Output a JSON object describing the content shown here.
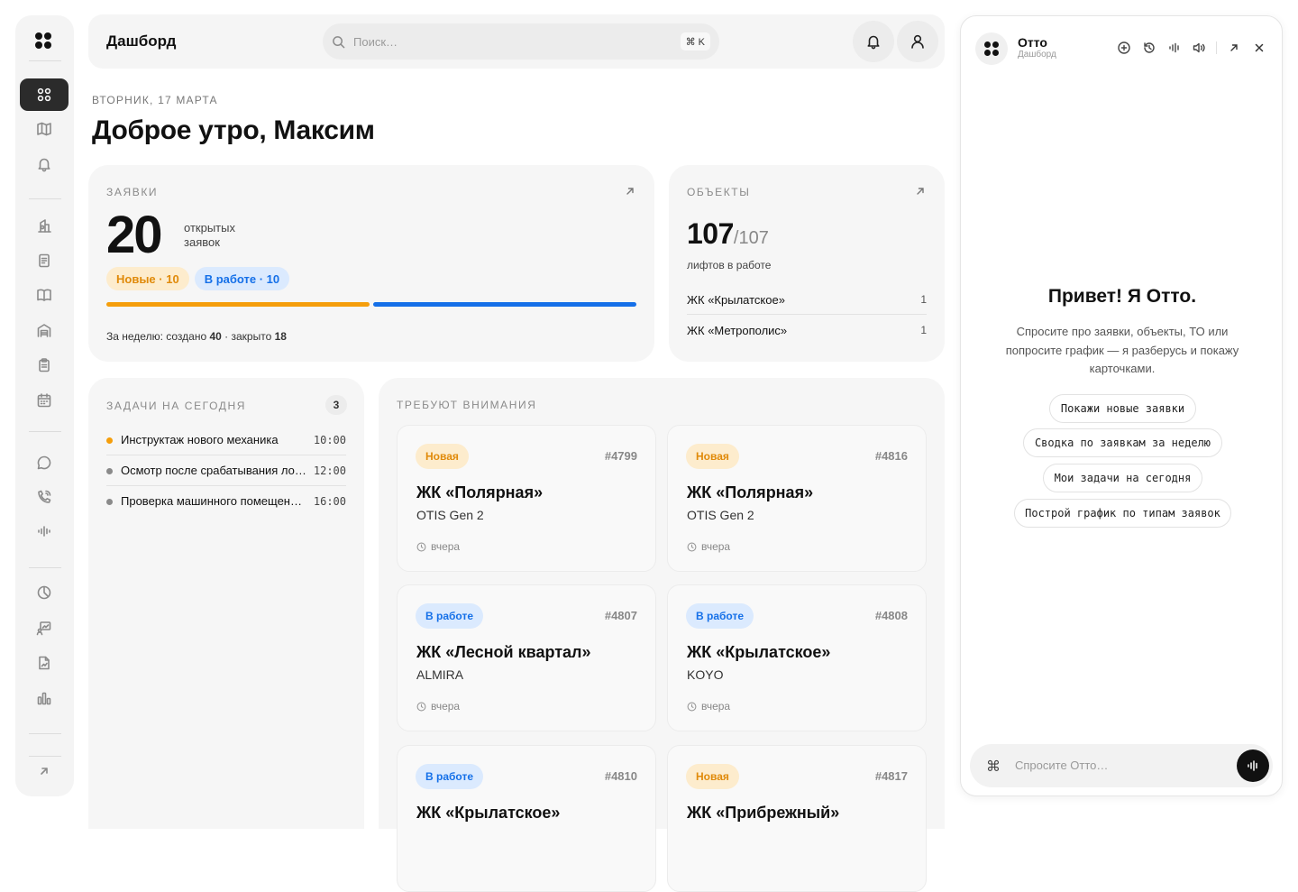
{
  "sidebar": {
    "items": [
      {
        "icon": "grid-icon",
        "active": true
      },
      {
        "icon": "map-icon"
      },
      {
        "icon": "bell-icon"
      },
      {
        "icon": "building-key-icon"
      },
      {
        "icon": "document-icon"
      },
      {
        "icon": "book-open-icon"
      },
      {
        "icon": "warehouse-icon"
      },
      {
        "icon": "clipboard-icon"
      },
      {
        "icon": "calendar-icon"
      },
      {
        "icon": "chat-icon"
      },
      {
        "icon": "phone-icon"
      },
      {
        "icon": "audio-wave-icon"
      },
      {
        "icon": "pie-chart-icon"
      },
      {
        "icon": "presentation-icon"
      },
      {
        "icon": "file-chart-icon"
      },
      {
        "icon": "bar-chart-icon"
      },
      {
        "icon": "expand-icon"
      }
    ]
  },
  "header": {
    "title": "Дашборд",
    "search_placeholder": "Поиск…",
    "shortcut": "⌘ K"
  },
  "greeting": {
    "date": "ВТОРНИК, 17 МАРТА",
    "title": "Доброе утро, Максим"
  },
  "requests": {
    "label": "ЗАЯВКИ",
    "count": "20",
    "count_caption_1": "открытых",
    "count_caption_2": "заявок",
    "new_label": "Новые ·",
    "new_count": "10",
    "work_label": "В работе ·",
    "work_count": "10",
    "progress": {
      "new_fraction": 0.5,
      "work_fraction": 0.5
    },
    "week_prefix": "За неделю: создано ",
    "week_created": "40",
    "week_mid": " · закрыто ",
    "week_closed": "18"
  },
  "objects": {
    "label": "ОБЪЕКТЫ",
    "working": "107",
    "total": "/107",
    "caption": "лифтов в работе",
    "rows": [
      {
        "name": "ЖК «Крылатское»",
        "value": "1"
      },
      {
        "name": "ЖК «Метрополис»",
        "value": "1"
      }
    ]
  },
  "tasks": {
    "label": "ЗАДАЧИ НА СЕГОДНЯ",
    "count": "3",
    "items": [
      {
        "title": "Инструктаж нового механика",
        "time": "10:00",
        "dot": "#f59e0b"
      },
      {
        "title": "Осмотр после срабатывания ло…",
        "time": "12:00",
        "dot": "#8a8a8a"
      },
      {
        "title": "Проверка машинного помещен…",
        "time": "16:00",
        "dot": "#8a8a8a"
      }
    ]
  },
  "attention": {
    "label": "ТРЕБУЮТ ВНИМАНИЯ",
    "cards": [
      {
        "status": "Новая",
        "kind": "new",
        "num": "#4799",
        "title": "ЖК «Полярная»",
        "model": "OTIS Gen 2",
        "when": "вчера"
      },
      {
        "status": "Новая",
        "kind": "new",
        "num": "#4816",
        "title": "ЖК «Полярная»",
        "model": "OTIS Gen 2",
        "when": "вчера"
      },
      {
        "status": "В работе",
        "kind": "work",
        "num": "#4807",
        "title": "ЖК «Лесной квартал»",
        "model": "ALMIRA",
        "when": "вчера"
      },
      {
        "status": "В работе",
        "kind": "work",
        "num": "#4808",
        "title": "ЖК «Крылатское»",
        "model": "KOYO",
        "when": "вчера"
      },
      {
        "status": "В работе",
        "kind": "work",
        "num": "#4810",
        "title": "ЖК «Крылатское»",
        "model": "",
        "when": ""
      },
      {
        "status": "Новая",
        "kind": "new",
        "num": "#4817",
        "title": "ЖК «Прибрежный»",
        "model": "",
        "when": ""
      }
    ]
  },
  "assistant": {
    "name": "Отто",
    "context": "Дашборд",
    "greeting": "Привет! Я Отто.",
    "intro_1": "Спросите про заявки, объекты, ТО или",
    "intro_2": "попросите график — я разберусь и покажу",
    "intro_3": "карточками.",
    "suggestions": [
      "Покажи новые заявки",
      "Сводка по заявкам за неделю",
      "Мои задачи на сегодня",
      "Построй график по типам заявок"
    ],
    "input_placeholder": "Спросите Отто…"
  },
  "colors": {
    "accent_new": "#f59e0b",
    "accent_work": "#1570e8",
    "dark": "#2b2b2b"
  }
}
